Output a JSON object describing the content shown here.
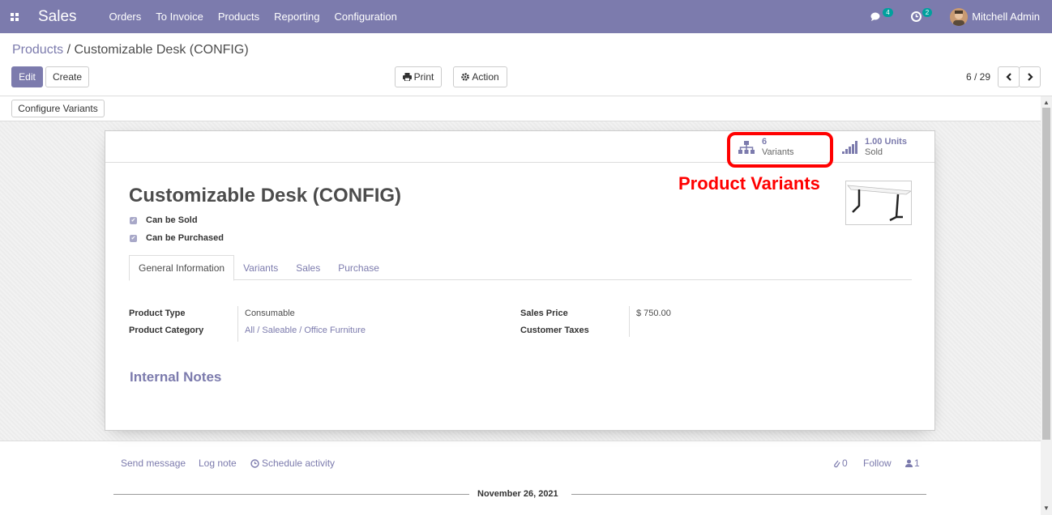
{
  "navbar": {
    "app_name": "Sales",
    "menu": [
      "Orders",
      "To Invoice",
      "Products",
      "Reporting",
      "Configuration"
    ],
    "messages_count": "4",
    "activities_count": "2",
    "user_name": "Mitchell Admin",
    "color": "#7c7bad"
  },
  "breadcrumb": {
    "parent": "Products",
    "separator": "/",
    "current": "Customizable Desk (CONFIG)"
  },
  "buttons": {
    "edit": "Edit",
    "create": "Create",
    "print": "Print",
    "action": "Action",
    "configure_variants": "Configure Variants"
  },
  "pager": {
    "value": "6 / 29"
  },
  "stats": {
    "variants_count": "6",
    "variants_label": "Variants",
    "sold_count": "1.00 Units",
    "sold_label": "Sold"
  },
  "annotation": {
    "text": "Product Variants",
    "color": "#ff0000"
  },
  "product": {
    "name": "Customizable Desk (CONFIG)",
    "can_be_sold": "Can be Sold",
    "can_be_purchased": "Can be Purchased"
  },
  "tabs": [
    "General Information",
    "Variants",
    "Sales",
    "Purchase"
  ],
  "fields": {
    "product_type_label": "Product Type",
    "product_type": "Consumable",
    "category_label": "Product Category",
    "category": "All / Saleable / Office Furniture",
    "sales_price_label": "Sales Price",
    "sales_price": "$ 750.00",
    "taxes_label": "Customer Taxes"
  },
  "notes_title": "Internal Notes",
  "chatter": {
    "send_message": "Send message",
    "log_note": "Log note",
    "schedule_activity": "Schedule activity",
    "attachments": "0",
    "follow": "Follow",
    "followers": "1",
    "date": "November 26, 2021"
  }
}
